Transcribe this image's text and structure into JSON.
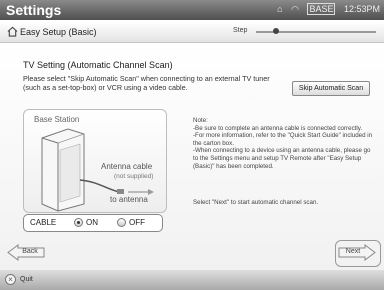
{
  "header": {
    "title": "Settings",
    "status_icons": [
      "home-icon",
      "wifi-icon",
      "network-icon"
    ],
    "network_label": "BASE",
    "time": "12:53PM"
  },
  "breadcrumb": {
    "label": "Easy Setup (Basic)",
    "step_label": "Step",
    "progress": 0.15
  },
  "content": {
    "heading": "TV Setting (Automatic Channel Scan)",
    "description": "Please select \"Skip Automatic Scan\" when connecting to an external TV tuner (such as a set-top-box) or VCR using a video cable.",
    "skip_button": "Skip Automatic Scan",
    "illustration": {
      "base_station": "Base Station",
      "antenna_cable": "Antenna cable",
      "not_supplied": "(not supplied)",
      "to_antenna": "to antenna"
    },
    "cable_toggle": {
      "label": "CABLE",
      "on_label": "ON",
      "off_label": "OFF",
      "selected": "ON"
    },
    "note": {
      "title": "Note:",
      "lines": [
        "-Be sure to complete an antenna cable is connected correctly.",
        "-For more information, refer to the \"Quick Start Guide\" included in the carton box.",
        "-When connecting to a device using an antenna cable, please go to the Settings menu and setup TV Remote after \"Easy Setup (Basic)\" has been completed."
      ]
    },
    "next_instruction": "Select \"Next\" to start automatic channel scan."
  },
  "nav": {
    "back": "Back",
    "next": "Next"
  },
  "footer": {
    "quit": "Quit"
  }
}
